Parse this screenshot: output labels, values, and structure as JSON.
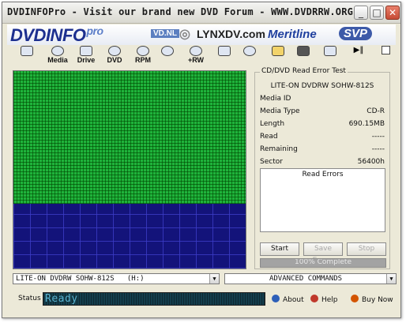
{
  "window": {
    "title": "DVDINFOPro  -  Visit our brand new DVD Forum  -  WWW.DVDRRW.ORG",
    "minimize": "_",
    "maximize": "□",
    "close": "✕"
  },
  "banner": {
    "logo": "DVDINFO",
    "logo_suffix": "pro",
    "sponsor1": "VD.NL",
    "sponsor2": "LYNXDV.com",
    "sponsor3": "Meritline",
    "sponsor4": "SVP"
  },
  "toolbar": {
    "items": [
      {
        "label": "",
        "icon": "monitor-icon"
      },
      {
        "label": "Media",
        "icon": "disc-icon"
      },
      {
        "label": "Drive",
        "icon": "drive-icon"
      },
      {
        "label": "DVD",
        "icon": "dvd-icon"
      },
      {
        "label": "RPM",
        "icon": "rpm-icon"
      },
      {
        "label": "",
        "icon": "scan-icon"
      },
      {
        "label": "+RW",
        "icon": "rw-icon"
      },
      {
        "label": "",
        "icon": "tools-icon"
      },
      {
        "label": "",
        "icon": "clock-icon"
      },
      {
        "label": "",
        "icon": "notes-icon"
      },
      {
        "label": "",
        "icon": "camera-icon"
      },
      {
        "label": "",
        "icon": "edit-icon"
      },
      {
        "label": "",
        "icon": "play-pause-icon"
      },
      {
        "label": "",
        "icon": "stop-icon"
      }
    ]
  },
  "panel": {
    "legend": "CD/DVD Read Error Test",
    "drive": "LITE-ON DVDRW SOHW-812S",
    "rows": [
      {
        "k": "Media ID",
        "v": ""
      },
      {
        "k": "Media Type",
        "v": "CD-R"
      },
      {
        "k": "Length",
        "v": "690.15MB"
      },
      {
        "k": "Read",
        "v": "-----"
      },
      {
        "k": "Remaining",
        "v": "-----"
      },
      {
        "k": "Sector",
        "v": "56400h"
      }
    ],
    "errors_header": "Read Errors",
    "start": "Start",
    "save_errors": "Save Errors",
    "stop": "Stop",
    "progress_text": "100% Complete",
    "progress": 1.0
  },
  "graph": {
    "read_fraction": 0.67,
    "colors": {
      "read": "#1fb33b",
      "unread": "#13137a"
    }
  },
  "drive_combo": {
    "value": "LITE-ON DVDRW SOHW-812S   (H:)"
  },
  "command_combo": {
    "value": "ADVANCED COMMANDS"
  },
  "status": {
    "label": "Status",
    "value": "Ready"
  },
  "links": {
    "about": "About",
    "help": "Help",
    "buy": "Buy Now"
  }
}
